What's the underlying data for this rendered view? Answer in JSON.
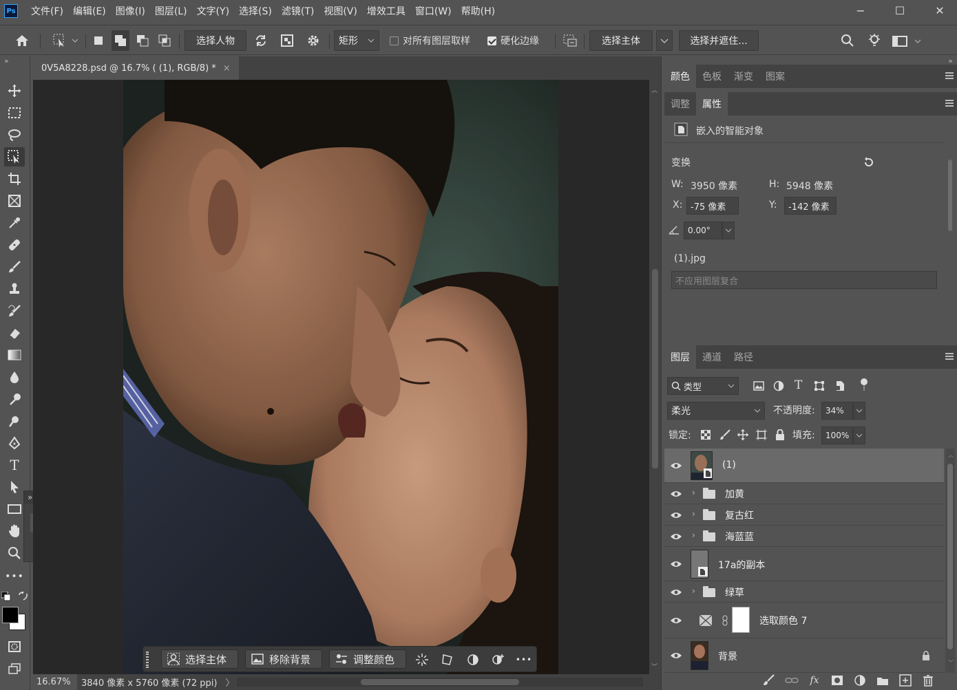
{
  "menubar": {
    "logo": "Ps",
    "items": [
      "文件(F)",
      "编辑(E)",
      "图像(I)",
      "图层(L)",
      "文字(Y)",
      "选择(S)",
      "滤镜(T)",
      "视图(V)",
      "增效工具",
      "窗口(W)",
      "帮助(H)"
    ],
    "minimize": "−",
    "maximize": "☐",
    "close": "✕"
  },
  "options": {
    "select_people": "选择人物",
    "shape": "矩形",
    "sample_all_layers": "对所有图层取样",
    "hard_edge": "硬化边缘",
    "select_subject": "选择主体",
    "select_and_mask": "选择并遮住..."
  },
  "document": {
    "tab_title": "0V5A8228.psd @ 16.7% ( (1), RGB/8) *",
    "tab_close": "×"
  },
  "status": {
    "zoom": "16.67%",
    "info": "3840 像素 x 5760 像素 (72 ppi)",
    "arrow": "〉"
  },
  "context_bar": {
    "select_subject": "选择主体",
    "remove_background": "移除背景",
    "adjust_color": "调整颜色",
    "more": "•••"
  },
  "panel_top": {
    "tabs": [
      "颜色",
      "色板",
      "渐变",
      "图案"
    ]
  },
  "properties": {
    "tabs": [
      "调整",
      "属性"
    ],
    "object_type": "嵌入的智能对象",
    "transform_label": "变换",
    "w_label": "W:",
    "w_value": "3950 像素",
    "h_label": "H:",
    "h_value": "5948 像素",
    "x_label": "X:",
    "x_value": "-75 像素",
    "y_label": "Y:",
    "y_value": "-142 像素",
    "angle_value": "0.00°",
    "file_name": "(1).jpg",
    "layer_comp": "不应用图层复合"
  },
  "layers_panel": {
    "tabs": [
      "图层",
      "通道",
      "路径"
    ],
    "filter_label": "类型",
    "blend_mode": "柔光",
    "opacity_label": "不透明度:",
    "opacity_value": "34%",
    "lock_label": "锁定:",
    "fill_label": "填充:",
    "fill_value": "100%",
    "layers": [
      {
        "name": "(1)",
        "type": "smart"
      },
      {
        "name": "加黄",
        "type": "group"
      },
      {
        "name": "复古红",
        "type": "group"
      },
      {
        "name": "海蓝蓝",
        "type": "group"
      },
      {
        "name": "17a的副本",
        "type": "smart"
      },
      {
        "name": "绿草",
        "type": "group"
      },
      {
        "name": "选取颜色 7",
        "type": "adjustment"
      },
      {
        "name": "背景",
        "type": "background"
      }
    ],
    "fx_label": "fx"
  },
  "floating_panel": {
    "collapse": "»",
    "close": "×"
  },
  "colors": {
    "ui_bg": "#535353",
    "ui_dark": "#424242",
    "canvas_bg": "#282828",
    "ps_blue": "#31a8ff"
  }
}
